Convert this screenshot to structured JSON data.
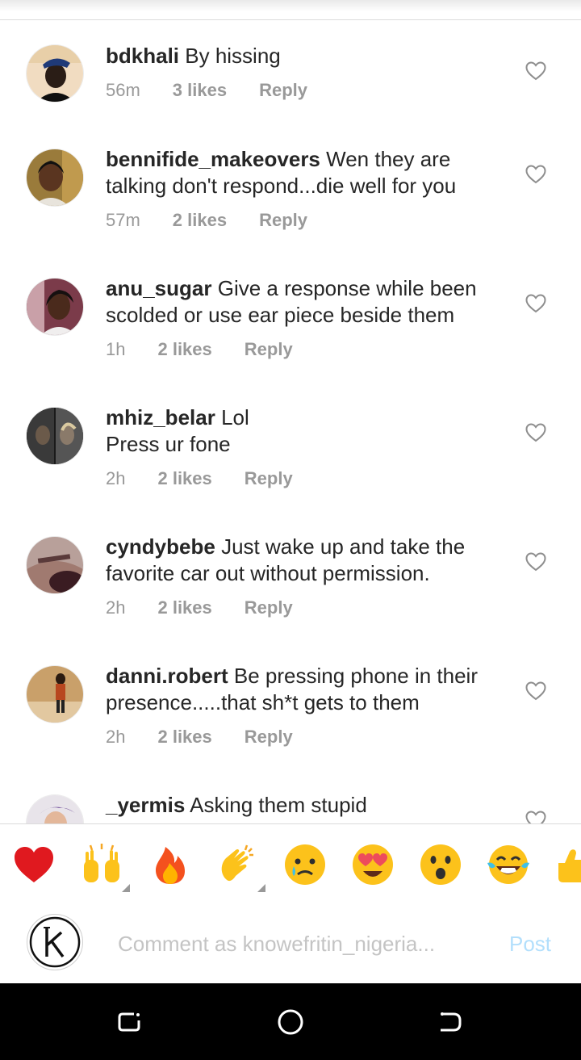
{
  "comments": [
    {
      "username": "bdkhali",
      "text": "By hissing",
      "time": "56m",
      "likes": "3 likes",
      "reply": "Reply"
    },
    {
      "username": "bennifide_makeovers",
      "text": "Wen they are talking don't respond...die well for you",
      "time": "57m",
      "likes": "2 likes",
      "reply": "Reply"
    },
    {
      "username": "anu_sugar",
      "text": "Give a response while been scolded or use ear piece beside them",
      "time": "1h",
      "likes": "2 likes",
      "reply": "Reply"
    },
    {
      "username": "mhiz_belar",
      "text": "Lol",
      "text2": "Press ur fone",
      "time": "2h",
      "likes": "2 likes",
      "reply": "Reply"
    },
    {
      "username": "cyndybebe",
      "text": "Just wake up and take the favorite car out without permission.",
      "time": "2h",
      "likes": "2 likes",
      "reply": "Reply"
    },
    {
      "username": "danni.robert",
      "text": "Be pressing phone in their presence.....that sh*t gets to them",
      "time": "2h",
      "likes": "2 likes",
      "reply": "Reply"
    },
    {
      "username": "_yermis",
      "text": "Asking them stupid"
    }
  ],
  "emoji_bar": {
    "items": [
      "red-heart",
      "raised-hands",
      "fire",
      "clapping-hands",
      "crying-face",
      "heart-eyes",
      "astonished-face",
      "tears-of-joy",
      "thumbs-up"
    ]
  },
  "composer": {
    "placeholder": "Comment as knowefritin_nigeria...",
    "post_label": "Post",
    "avatar_letter": "k"
  },
  "colors": {
    "text": "#262626",
    "meta": "#999999",
    "post_disabled": "#b2dffc",
    "navbar": "#000000"
  },
  "navbar": {
    "buttons": [
      "recents-icon",
      "home-icon",
      "back-icon"
    ]
  }
}
